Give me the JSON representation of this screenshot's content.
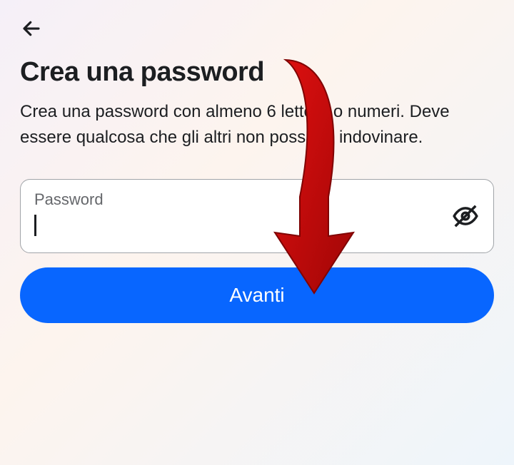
{
  "title": "Crea una password",
  "description": "Crea una password con almeno 6 lettere o numeri. Deve essere qualcosa che gli altri non possano indovinare.",
  "password_label": "Password",
  "password_value": "",
  "next_button_label": "Avanti",
  "colors": {
    "primary": "#0866ff",
    "text": "#1c1e21",
    "secondary_text": "#65676b",
    "border": "#a0a4a8"
  },
  "annotation": {
    "arrow_color": "#c00808"
  }
}
